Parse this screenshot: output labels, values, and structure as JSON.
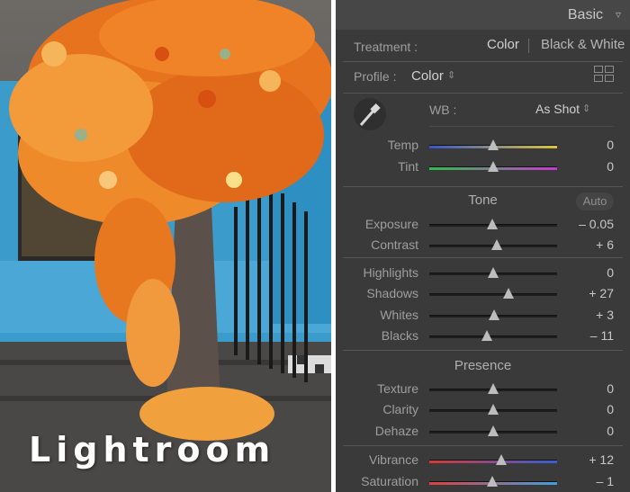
{
  "photo": {
    "watermark": "Lightroom",
    "alt_subject": "orange-flower-tree-photo"
  },
  "panel": {
    "title": "Basic",
    "treatment": {
      "label": "Treatment :",
      "options": [
        "Color",
        "Black & White"
      ],
      "selected": "Color"
    },
    "profile": {
      "label": "Profile :",
      "value": "Color",
      "arrow": "⇕"
    },
    "wb": {
      "label": "WB :",
      "value": "As Shot",
      "arrow": "⇕"
    },
    "sliders_wb": [
      {
        "label": "Temp",
        "value": "0",
        "position": 0.5
      },
      {
        "label": "Tint",
        "value": "0",
        "position": 0.5
      }
    ],
    "tone": {
      "title": "Tone",
      "auto_label": "Auto",
      "group1": [
        {
          "label": "Exposure",
          "value": "– 0.05",
          "position": 0.49
        },
        {
          "label": "Contrast",
          "value": "+ 6",
          "position": 0.53
        }
      ],
      "group2": [
        {
          "label": "Highlights",
          "value": "0",
          "position": 0.5
        },
        {
          "label": "Shadows",
          "value": "+ 27",
          "position": 0.62
        },
        {
          "label": "Whites",
          "value": "+ 3",
          "position": 0.51
        },
        {
          "label": "Blacks",
          "value": "– 11",
          "position": 0.45
        }
      ]
    },
    "presence": {
      "title": "Presence",
      "group1": [
        {
          "label": "Texture",
          "value": "0",
          "position": 0.5
        },
        {
          "label": "Clarity",
          "value": "0",
          "position": 0.5
        },
        {
          "label": "Dehaze",
          "value": "0",
          "position": 0.5
        }
      ],
      "group2": [
        {
          "label": "Vibrance",
          "value": "+ 12",
          "position": 0.56
        },
        {
          "label": "Saturation",
          "value": "– 1",
          "position": 0.49
        }
      ]
    },
    "colors": {
      "panel_bg": "#3a3a3a",
      "header_bg": "#474747",
      "temp_gradient": [
        "#3a55c7",
        "#d9c43a"
      ],
      "tint_gradient": [
        "#2fbf4a",
        "#c63ad0"
      ]
    }
  }
}
